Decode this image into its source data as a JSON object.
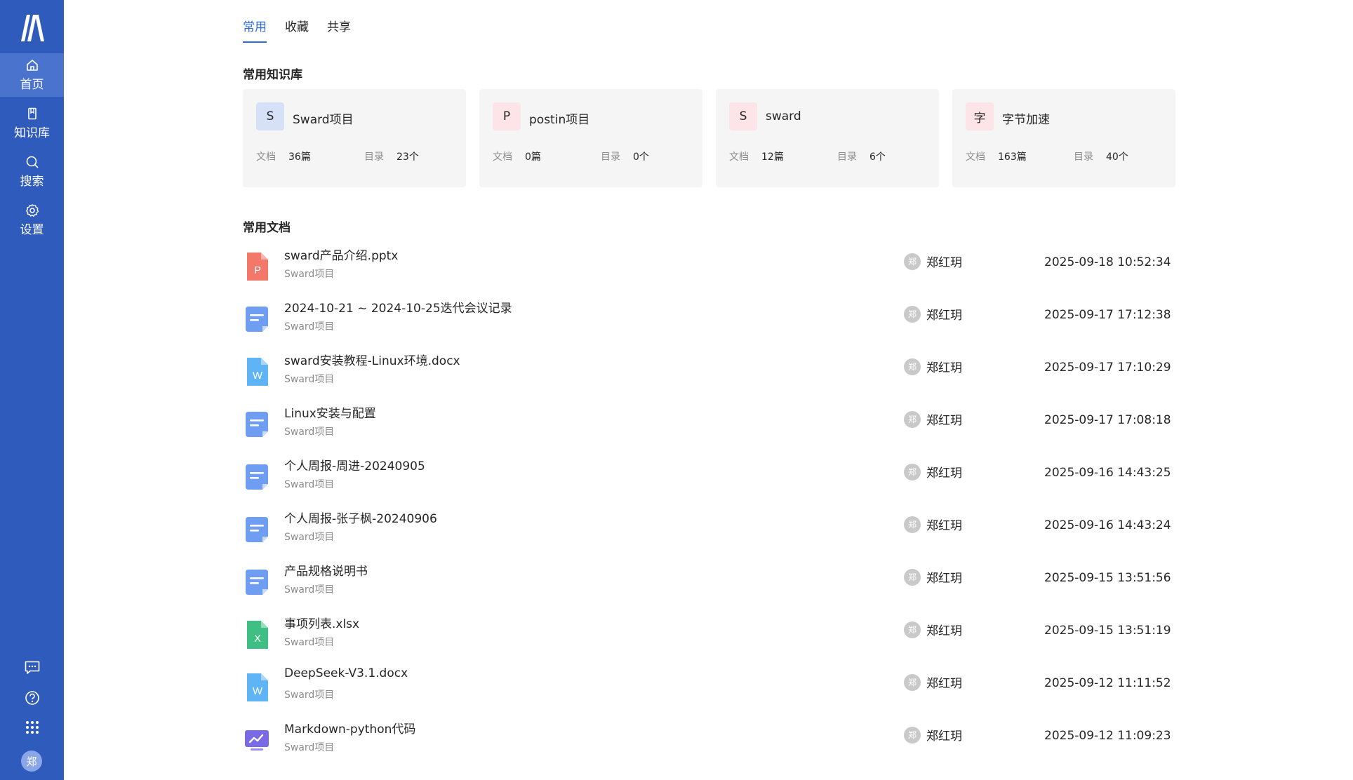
{
  "sidebar": {
    "nav": [
      {
        "label": "首页",
        "icon": "home-icon",
        "active": true
      },
      {
        "label": "知识库",
        "icon": "book-icon",
        "active": false
      },
      {
        "label": "搜索",
        "icon": "search-icon",
        "active": false
      },
      {
        "label": "设置",
        "icon": "gear-icon",
        "active": false
      }
    ],
    "avatar_text": "郑"
  },
  "tabs": [
    "常用",
    "收藏",
    "共享"
  ],
  "repos_title": "常用知识库",
  "repos": [
    {
      "avatar": "S",
      "name": "Sward项目",
      "doc_label": "文档",
      "doc_count": "36篇",
      "dir_label": "目录",
      "dir_count": "23个",
      "avatar_bg": "#d6e1f7"
    },
    {
      "avatar": "P",
      "name": "postin项目",
      "doc_label": "文档",
      "doc_count": "0篇",
      "dir_label": "目录",
      "dir_count": "0个",
      "avatar_bg": "#fde4e8"
    },
    {
      "avatar": "S",
      "name": "sward",
      "doc_label": "文档",
      "doc_count": "12篇",
      "dir_label": "目录",
      "dir_count": "6个",
      "avatar_bg": "#fde4e8"
    },
    {
      "avatar": "字",
      "name": "字节加速",
      "doc_label": "文档",
      "doc_count": "163篇",
      "dir_label": "目录",
      "dir_count": "40个",
      "avatar_bg": "#fde4e8"
    }
  ],
  "docs_title": "常用文档",
  "docs": [
    {
      "title": "sward产品介绍.pptx",
      "repo": "Sward项目",
      "user": "郑红玥",
      "user_avatar": "郑",
      "time": "2025-09-18 10:52:34",
      "icon": "ppt-file-icon"
    },
    {
      "title": "2024-10-21 ~ 2024-10-25迭代会议记录",
      "repo": "Sward项目",
      "user": "郑红玥",
      "user_avatar": "郑",
      "time": "2025-09-17 17:12:38",
      "icon": "document-icon"
    },
    {
      "title": "sward安装教程-Linux环境.docx",
      "repo": "Sward项目",
      "user": "郑红玥",
      "user_avatar": "郑",
      "time": "2025-09-17 17:10:29",
      "icon": "word-file-icon"
    },
    {
      "title": "Linux安装与配置",
      "repo": "Sward项目",
      "user": "郑红玥",
      "user_avatar": "郑",
      "time": "2025-09-17 17:08:18",
      "icon": "document-icon"
    },
    {
      "title": "个人周报-周进-20240905",
      "repo": "Sward项目",
      "user": "郑红玥",
      "user_avatar": "郑",
      "time": "2025-09-16 14:43:25",
      "icon": "document-icon"
    },
    {
      "title": "个人周报-张子枫-20240906",
      "repo": "Sward项目",
      "user": "郑红玥",
      "user_avatar": "郑",
      "time": "2025-09-16 14:43:24",
      "icon": "document-icon"
    },
    {
      "title": "产品规格说明书",
      "repo": "Sward项目",
      "user": "郑红玥",
      "user_avatar": "郑",
      "time": "2025-09-15 13:51:56",
      "icon": "document-icon"
    },
    {
      "title": "事项列表.xlsx",
      "repo": "Sward项目",
      "user": "郑红玥",
      "user_avatar": "郑",
      "time": "2025-09-15 13:51:19",
      "icon": "excel-file-icon"
    },
    {
      "title": "DeepSeek-V3.1.docx",
      "repo": "Sward项目",
      "user": "郑红玥",
      "user_avatar": "郑",
      "time": "2025-09-12 11:11:52",
      "icon": "word-file-icon"
    },
    {
      "title": "Markdown-python代码",
      "repo": "Sward项目",
      "user": "郑红玥",
      "user_avatar": "郑",
      "time": "2025-09-12 11:09:23",
      "icon": "markdown-icon"
    }
  ],
  "colors": {
    "sidebar": "#2f5bbd",
    "accent": "#2f6ad9",
    "ppt": "#f4786a",
    "word": "#5fb4f5",
    "excel": "#3fbf83",
    "doc": "#6f9df2",
    "markdown": "#7a6ae6"
  }
}
